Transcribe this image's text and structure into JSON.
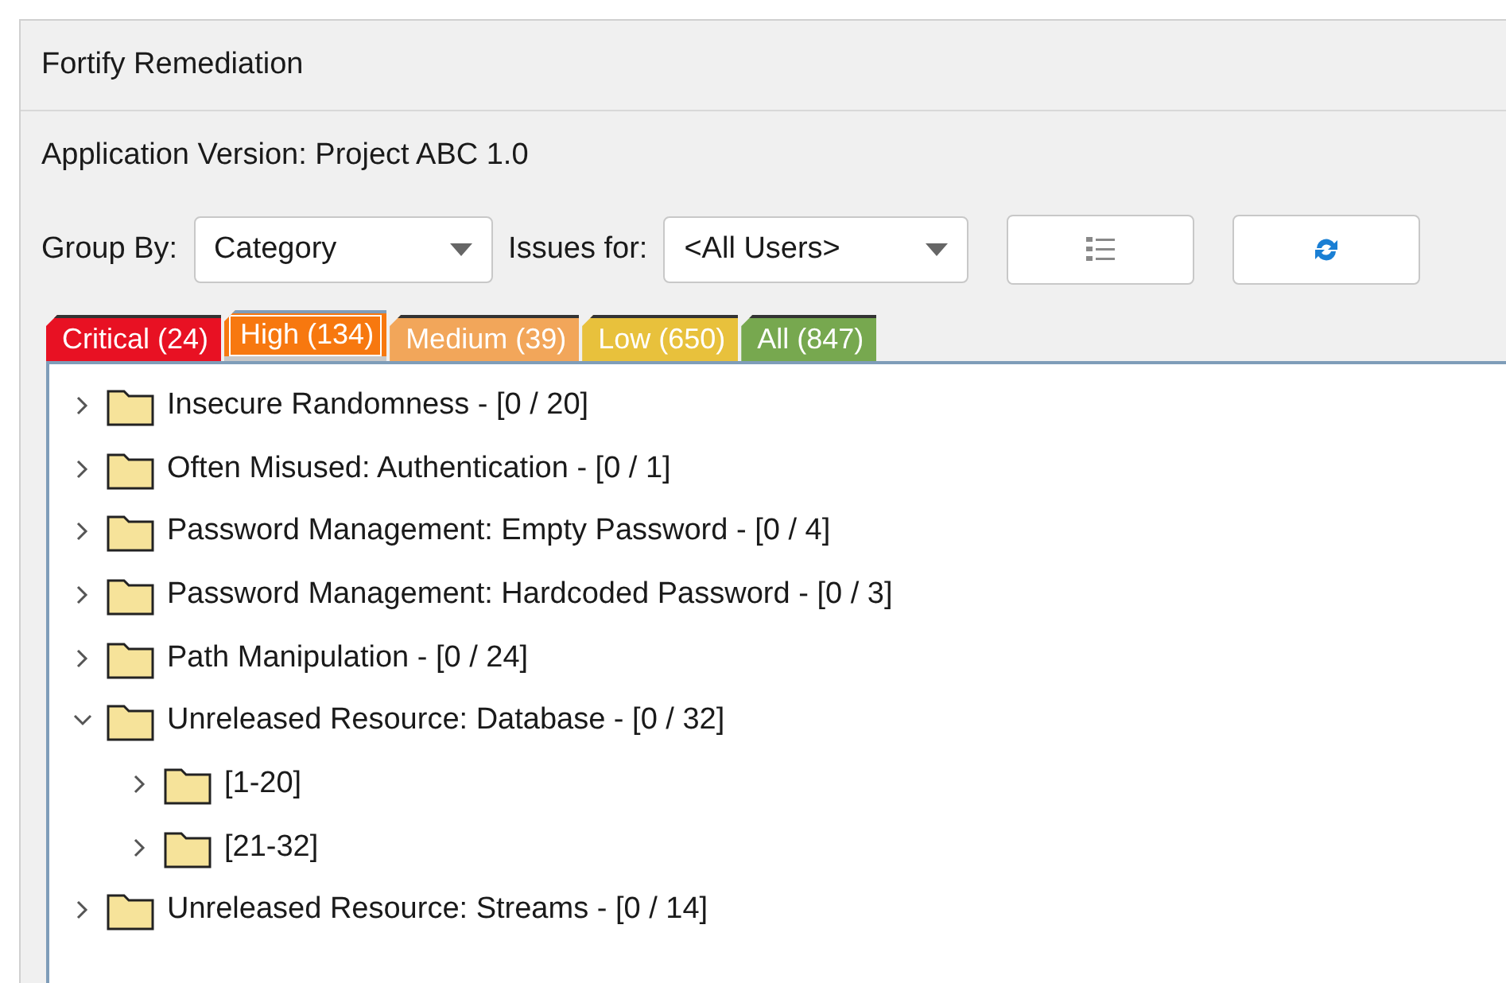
{
  "panel": {
    "title": "Fortify Remediation"
  },
  "application_version": "Application Version: Project ABC 1.0",
  "toolbar": {
    "group_by_label": "Group By:",
    "group_by_value": "Category",
    "issues_for_label": "Issues for:",
    "issues_for_value": "<All Users>"
  },
  "tabs": [
    {
      "label": "Critical (24)",
      "selected": false,
      "color": "#e81123"
    },
    {
      "label": "High (134)",
      "selected": true,
      "color": "#f7780f"
    },
    {
      "label": "Medium (39)",
      "selected": false,
      "color": "#f2a65a"
    },
    {
      "label": "Low (650)",
      "selected": false,
      "color": "#e8c13c"
    },
    {
      "label": "All (847)",
      "selected": false,
      "color": "#77a84f"
    }
  ],
  "tree": [
    {
      "label": "Insecure Randomness - [0 / 20]",
      "expanded": false
    },
    {
      "label": "Often Misused: Authentication - [0 / 1]",
      "expanded": false
    },
    {
      "label": "Password Management: Empty Password - [0 / 4]",
      "expanded": false
    },
    {
      "label": "Password Management: Hardcoded Password - [0 / 3]",
      "expanded": false
    },
    {
      "label": "Path Manipulation - [0 / 24]",
      "expanded": false
    },
    {
      "label": "Unreleased Resource: Database - [0 / 32]",
      "expanded": true,
      "children": [
        {
          "label": "[1-20]",
          "expanded": false
        },
        {
          "label": "[21-32]",
          "expanded": false
        }
      ]
    },
    {
      "label": "Unreleased Resource: Streams - [0 / 14]",
      "expanded": false
    }
  ]
}
